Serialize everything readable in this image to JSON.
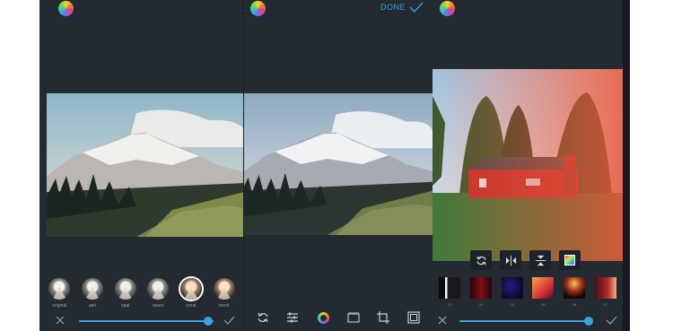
{
  "panels": {
    "filters": {
      "items": [
        {
          "label": "original"
        },
        {
          "label": "ash"
        },
        {
          "label": "opal"
        },
        {
          "label": "raven"
        },
        {
          "label": "coral"
        },
        {
          "label": "merit"
        }
      ],
      "selected_index": 4,
      "intensity": 0.92
    },
    "edit": {
      "done_label": "DONE",
      "tools": [
        "rotate-icon",
        "adjust-icon",
        "color-wheel-icon",
        "film-icon",
        "crop-icon",
        "frame-icon"
      ]
    },
    "overlay": {
      "transform_buttons": [
        "rotate-icon",
        "flip-horizontal-icon",
        "flip-vertical-icon",
        "color-icon"
      ],
      "items": [
        {
          "label": "22"
        },
        {
          "label": "23"
        },
        {
          "label": "24"
        },
        {
          "label": "25"
        },
        {
          "label": "26"
        },
        {
          "label": "27"
        }
      ],
      "intensity": 0.92
    }
  },
  "colors": {
    "accent": "#3aa3e0",
    "panel_bg": "#232a32"
  }
}
